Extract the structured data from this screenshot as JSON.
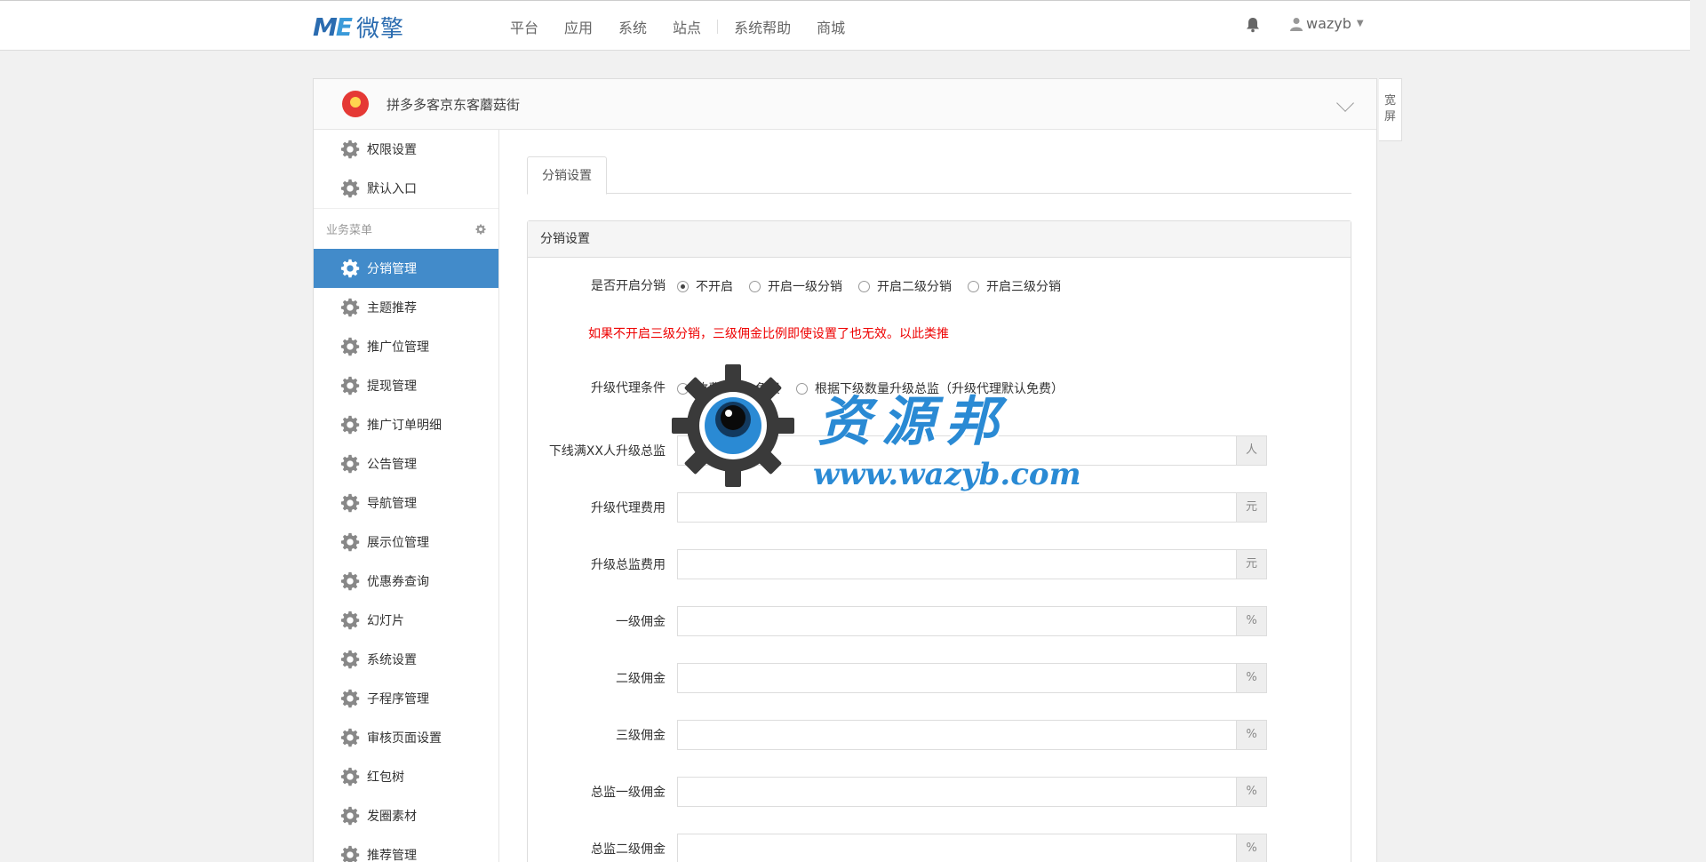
{
  "header": {
    "logo_mark_m": "M",
    "logo_mark_e": "E",
    "logo_text": "微擎",
    "nav": [
      "平台",
      "应用",
      "系统",
      "站点",
      "系统帮助",
      "商城"
    ],
    "username": "wazyb"
  },
  "shop": {
    "name": "拼多多客京东客蘑菇街",
    "widescreen_label_1": "宽",
    "widescreen_label_2": "屏"
  },
  "sidebar": {
    "top_items": [
      {
        "label": "权限设置",
        "icon": "gear-icon"
      },
      {
        "label": "默认入口",
        "icon": "gear-icon"
      }
    ],
    "group_title": "业务菜单",
    "items": [
      {
        "label": "分销管理",
        "active": true
      },
      {
        "label": "主题推荐"
      },
      {
        "label": "推广位管理"
      },
      {
        "label": "提现管理"
      },
      {
        "label": "推广订单明细"
      },
      {
        "label": "公告管理"
      },
      {
        "label": "导航管理"
      },
      {
        "label": "展示位管理"
      },
      {
        "label": "优惠券查询"
      },
      {
        "label": "幻灯片"
      },
      {
        "label": "系统设置"
      },
      {
        "label": "子程序管理"
      },
      {
        "label": "审核页面设置"
      },
      {
        "label": "红包树"
      },
      {
        "label": "发圈素材"
      },
      {
        "label": "推荐管理"
      }
    ],
    "active_color": "#428bca"
  },
  "content": {
    "tab": "分销设置",
    "box_title": "分销设置",
    "distribution": {
      "label": "是否开启分销",
      "options": [
        "不开启",
        "开启一级分销",
        "开启二级分销",
        "开启三级分销"
      ],
      "selected": "不开启"
    },
    "warning": "如果不开启三级分销，三级佣金比例即使设置了也无效。以此类推",
    "warning_color": "#ee0000",
    "upgrade": {
      "label": "升级代理条件",
      "options": [
        "收费",
        "免费",
        "根据下级数量升级总监（升级代理默认免费）"
      ]
    },
    "fields": [
      {
        "label": "下线满XX人升级总监",
        "value": "",
        "unit": "人"
      },
      {
        "label": "升级代理费用",
        "value": "",
        "unit": "元"
      },
      {
        "label": "升级总监费用",
        "value": "",
        "unit": "元"
      },
      {
        "label": "一级佣金",
        "value": "",
        "unit": "%"
      },
      {
        "label": "二级佣金",
        "value": "",
        "unit": "%"
      },
      {
        "label": "三级佣金",
        "value": "",
        "unit": "%"
      },
      {
        "label": "总监一级佣金",
        "value": "",
        "unit": "%"
      },
      {
        "label": "总监二级佣金",
        "value": "",
        "unit": "%"
      }
    ]
  },
  "watermark": {
    "title": "资源邦",
    "url": "www.wazyb.com",
    "color": "#2a8ad4"
  }
}
